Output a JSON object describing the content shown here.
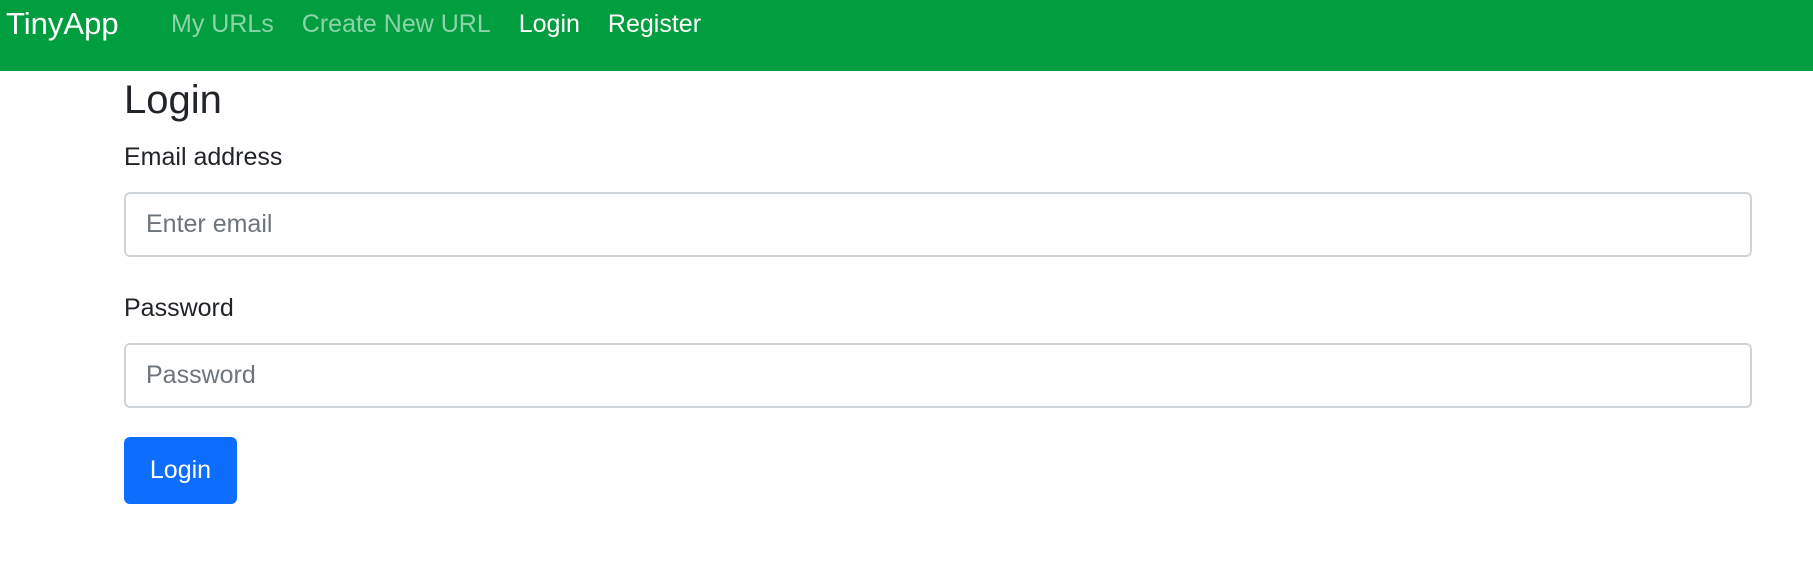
{
  "navbar": {
    "brand": "TinyApp",
    "links": [
      {
        "label": "My URLs",
        "state": "muted"
      },
      {
        "label": "Create New URL",
        "state": "muted"
      },
      {
        "label": "Login",
        "state": "active"
      },
      {
        "label": "Register",
        "state": "active"
      }
    ],
    "background_color": "#009e3f"
  },
  "main": {
    "title": "Login",
    "email": {
      "label": "Email address",
      "placeholder": "Enter email",
      "value": ""
    },
    "password": {
      "label": "Password",
      "placeholder": "Password",
      "value": ""
    },
    "submit_label": "Login",
    "submit_color": "#0d6efd"
  }
}
